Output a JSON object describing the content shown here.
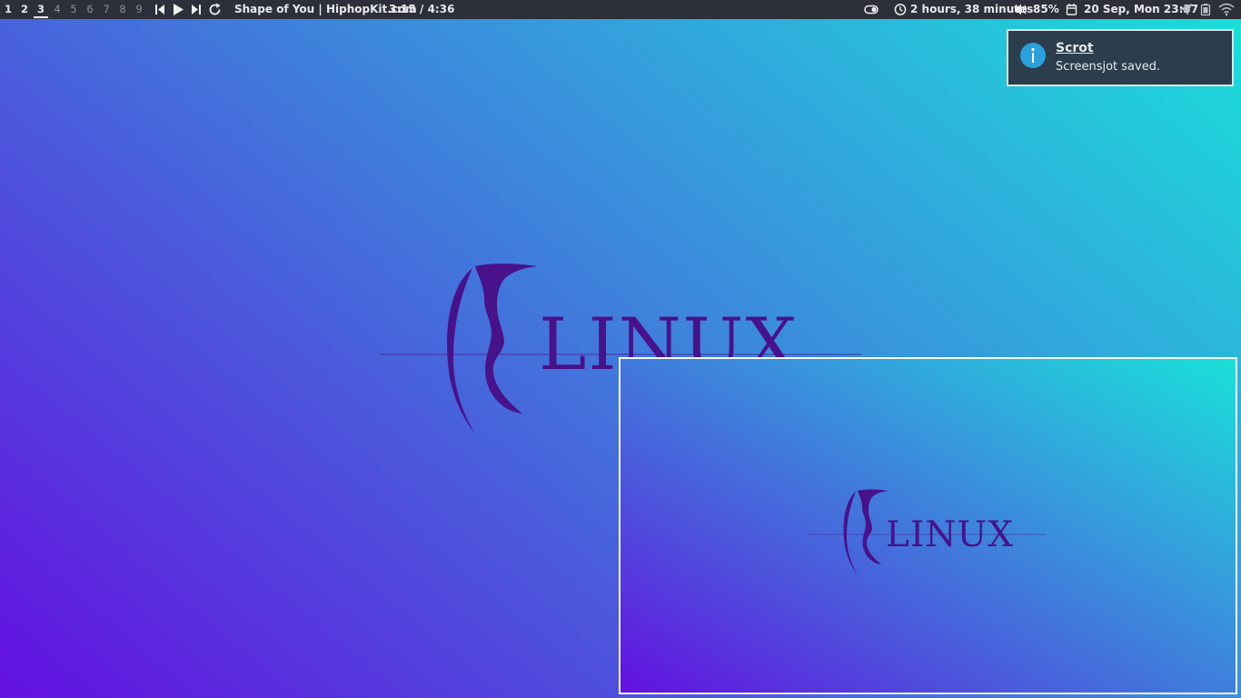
{
  "topbar": {
    "workspaces": [
      {
        "label": "1",
        "state": "occupied"
      },
      {
        "label": "2",
        "state": "occupied"
      },
      {
        "label": "3",
        "state": "active"
      },
      {
        "label": "4",
        "state": "empty"
      },
      {
        "label": "5",
        "state": "empty"
      },
      {
        "label": "6",
        "state": "empty"
      },
      {
        "label": "7",
        "state": "empty"
      },
      {
        "label": "8",
        "state": "empty"
      },
      {
        "label": "9",
        "state": "empty"
      }
    ],
    "media": {
      "track": "Shape of You | HiphopKit.com",
      "time": "3:15 / 4:36",
      "controls": [
        "skip-previous-icon",
        "play-icon",
        "skip-next-icon",
        "repeat-icon"
      ]
    },
    "status": {
      "battery_time": "2 hours, 38 minutes",
      "volume": "85%",
      "datetime": "20 Sep, Mon 23:37"
    }
  },
  "notification": {
    "title": "Scrot",
    "body": "Screensjot saved.",
    "icon": "info-icon",
    "accent": "#2aa0dc"
  },
  "wallpaper": {
    "logo_text": "LINUX",
    "colors": [
      "#6410e0",
      "#3d86dc",
      "#19e0d8"
    ],
    "logo_color": "#47128a"
  },
  "preview": {
    "logo_text": "LINUX"
  }
}
